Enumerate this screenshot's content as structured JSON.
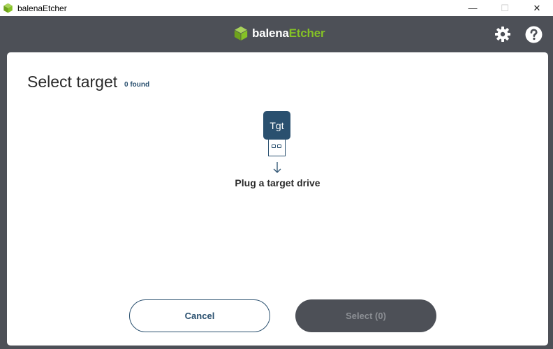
{
  "window": {
    "title": "balenaEtcher",
    "minimize_glyph": "—",
    "maximize_glyph": "☐",
    "close_glyph": "✕"
  },
  "header": {
    "brand_part_a": "balena",
    "brand_part_b": "Etcher",
    "logo_icon": "cube-logo-icon",
    "settings_icon": "gear-icon",
    "help_icon": "help-circle-icon",
    "accent_color": "#85c226"
  },
  "modal": {
    "title": "Select target",
    "found_count": "0 found",
    "drive_badge": "Tgt",
    "message": "Plug a target drive",
    "cancel_label": "Cancel",
    "select_label": "Select (0)"
  },
  "colors": {
    "header_bg": "#4d5057",
    "primary": "#2a506f",
    "disabled_button": "#4d5057"
  }
}
